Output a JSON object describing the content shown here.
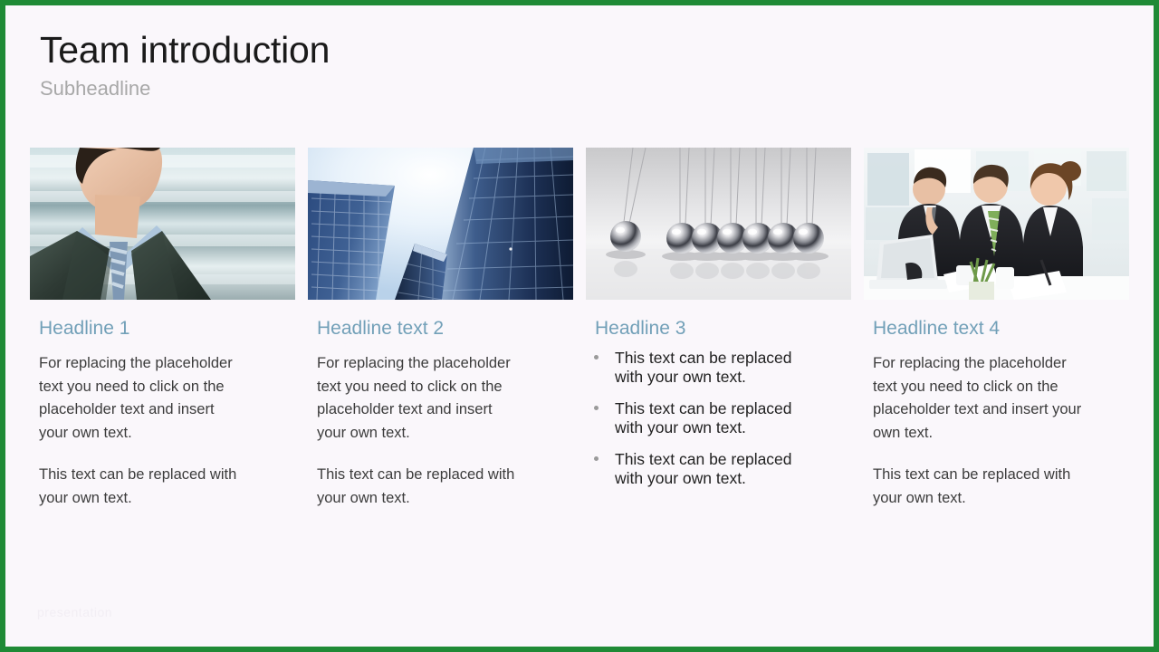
{
  "theme": {
    "border_color": "#1f8a36",
    "background_color": "#faf7fb",
    "title_color": "#1a1a1a",
    "subtitle_color": "#a8a8a8",
    "headline_color": "#72a0b8",
    "body_color": "#3c3c3c"
  },
  "header": {
    "title": "Team introduction",
    "subtitle": "Subheadline"
  },
  "columns": [
    {
      "image_name": "businessman-portrait-photo",
      "image_alt": "Businessman in dark suit and blue shirt with striped tie",
      "headline": "Headline 1",
      "paragraphs": [
        "For replacing the placeholder text you need to click on the placeholder text and insert your own text.",
        "This text can be replaced with your own text."
      ]
    },
    {
      "image_name": "skyscrapers-upward-view-photo",
      "image_alt": "Upward view of blue glass office skyscrapers against bright sky",
      "headline": "Headline text 2",
      "paragraphs": [
        "For replacing the placeholder text you need to click on the placeholder text and insert your own text.",
        "This text can be replaced with your own text."
      ]
    },
    {
      "image_name": "newtons-cradle-photo",
      "image_alt": "Newton's cradle with chrome spheres, one ball swung aside",
      "headline": "Headline 3",
      "bullets": [
        "This text can be replaced with your own text.",
        "This text can be replaced with your own text.",
        "This text can be replaced with your own text."
      ]
    },
    {
      "image_name": "business-team-meeting-photo",
      "image_alt": "Three business colleagues reviewing documents around a laptop in an office",
      "headline": "Headline text 4",
      "paragraphs": [
        "For replacing the placeholder text you need to click on the placeholder text and insert your own text.",
        "This text can be replaced with your own text."
      ]
    }
  ],
  "watermark": {
    "text": "presentation"
  }
}
